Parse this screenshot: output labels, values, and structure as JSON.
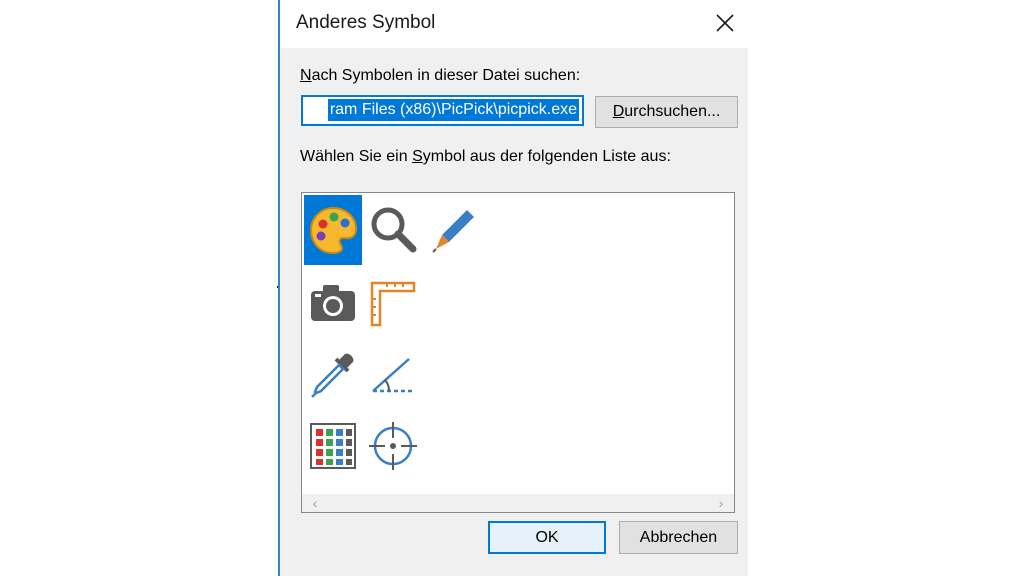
{
  "dialog": {
    "title": "Anderes Symbol",
    "search_label": {
      "accel": "N",
      "rest": "ach Symbolen in dieser Datei suchen:"
    },
    "file_path": "ram Files (x86)\\PicPick\\picpick.exe",
    "browse_button": {
      "accel": "D",
      "rest": "urchsuchen..."
    },
    "list_label": {
      "before": "Wählen Sie ein ",
      "accel": "S",
      "after": "ymbol aus der folgenden Liste aus:"
    },
    "ok_label": "OK",
    "cancel_label": "Abbrechen"
  },
  "icons": [
    {
      "name": "palette-icon",
      "selected": true
    },
    {
      "name": "magnifier-icon",
      "selected": false
    },
    {
      "name": "pen-icon",
      "selected": false
    },
    {
      "name": "camera-icon",
      "selected": false
    },
    {
      "name": "ruler-icon",
      "selected": false
    },
    {
      "name": "eyedropper-icon",
      "selected": false
    },
    {
      "name": "protractor-icon",
      "selected": false
    },
    {
      "name": "color-grid-icon",
      "selected": false
    },
    {
      "name": "crosshair-icon",
      "selected": false
    }
  ],
  "colors": {
    "accent": "#0078d7",
    "icon_blue": "#3a7fc4",
    "icon_gray": "#5a5a5a",
    "icon_orange": "#e0852a"
  }
}
